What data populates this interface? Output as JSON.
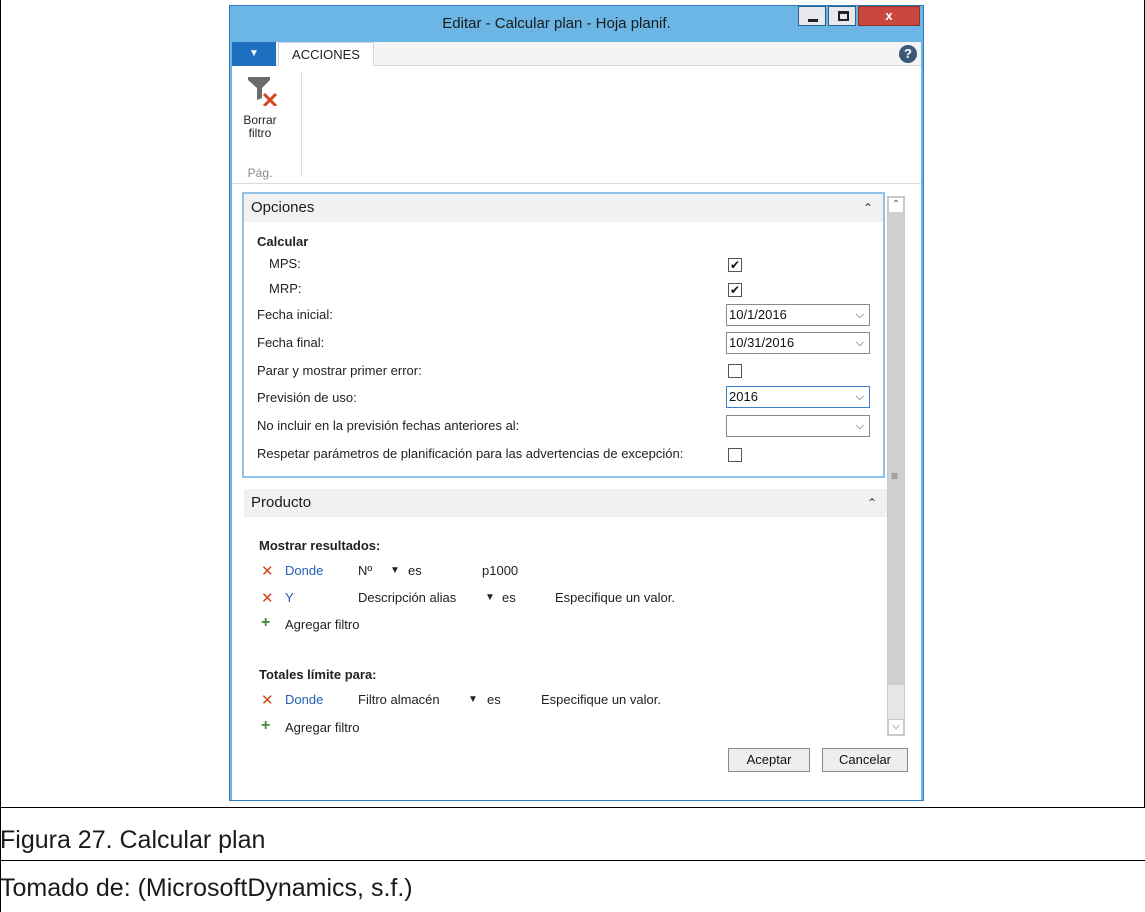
{
  "window": {
    "title": "Editar - Calcular plan - Hoja planif.",
    "minimize": "–",
    "close": "x"
  },
  "ribbon": {
    "dropdown_caret": "▼",
    "tab_acciones": "ACCIONES",
    "help": "?",
    "filter_label_1": "Borrar",
    "filter_label_2": "filtro",
    "group_label": "Pág."
  },
  "opciones": {
    "header": "Opciones",
    "calcular": "Calcular",
    "mps_label": "MPS:",
    "mps_checked": "✔",
    "mrp_label": "MRP:",
    "mrp_checked": "✔",
    "fecha_inicial_label": "Fecha inicial:",
    "fecha_inicial_value": "10/1/2016",
    "fecha_final_label": "Fecha final:",
    "fecha_final_value": "10/31/2016",
    "parar_label": "Parar y mostrar primer error:",
    "prevision_label": "Previsión de uso:",
    "prevision_value": "2016",
    "no_incluir_label": "No incluir en la previsión fechas anteriores al:",
    "no_incluir_value": "",
    "respetar_label": "Respetar parámetros de planificación para las advertencias de excepción:"
  },
  "producto": {
    "header": "Producto",
    "mostrar_resultados": "Mostrar resultados:",
    "row1": {
      "conj": "Donde",
      "field": "Nº",
      "op": "es",
      "value": "p1000"
    },
    "row2": {
      "conj": "Y",
      "field": "Descripción alias",
      "op": "es",
      "value": "Especifique un valor."
    },
    "agregar_filtro_1": "Agregar filtro",
    "totales": "Totales límite para:",
    "row3": {
      "conj": "Donde",
      "field": "Filtro almacén",
      "op": "es",
      "value": "Especifique un valor."
    },
    "agregar_filtro_2": "Agregar filtro"
  },
  "buttons": {
    "aceptar": "Aceptar",
    "cancelar": "Cancelar"
  },
  "caption": {
    "figure": "Figura 27. Calcular plan",
    "source": "Tomado de: (MicrosoftDynamics, s.f.)"
  },
  "colors": {
    "titlebar": "#6cb6e6",
    "accent": "#1e6fbf",
    "close": "#c9473d",
    "link": "#1f5fb4",
    "remove": "#d2451e",
    "add": "#3a8a3a"
  },
  "icons": [
    "funnel-clear-icon",
    "help-icon",
    "close-icon",
    "minimize-icon",
    "maximize-icon",
    "chevron-up-icon",
    "chevron-down-icon",
    "remove-filter-icon",
    "add-filter-icon",
    "scroll-up-icon",
    "scroll-down-icon"
  ]
}
